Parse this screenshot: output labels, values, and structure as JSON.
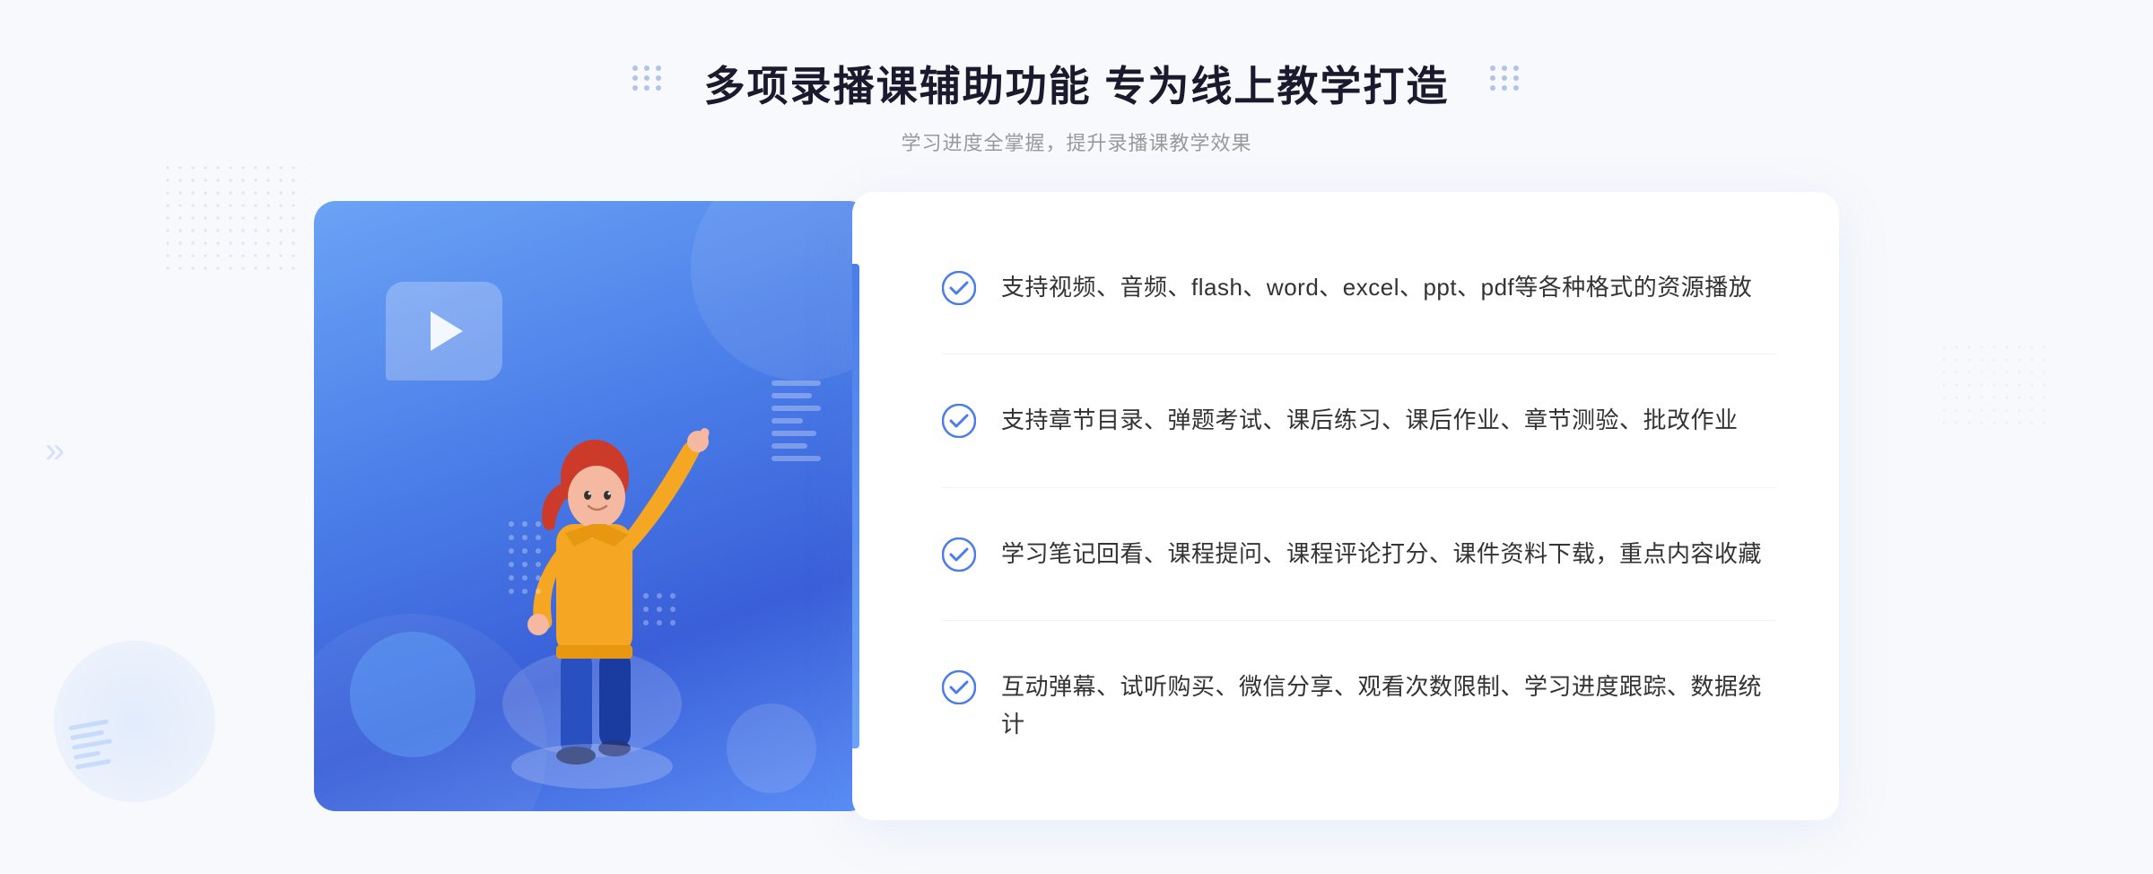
{
  "header": {
    "title": "多项录播课辅助功能 专为线上教学打造",
    "subtitle": "学习进度全掌握，提升录播课教学效果"
  },
  "features": [
    {
      "id": "feature-1",
      "text": "支持视频、音频、flash、word、excel、ppt、pdf等各种格式的资源播放"
    },
    {
      "id": "feature-2",
      "text": "支持章节目录、弹题考试、课后练习、课后作业、章节测验、批改作业"
    },
    {
      "id": "feature-3",
      "text": "学习笔记回看、课程提问、课程评论打分、课件资料下载，重点内容收藏"
    },
    {
      "id": "feature-4",
      "text": "互动弹幕、试听购买、微信分享、观看次数限制、学习进度跟踪、数据统计"
    }
  ],
  "colors": {
    "primary": "#4a7de8",
    "primary_light": "#6ba3f5",
    "text_dark": "#1a1a2e",
    "text_medium": "#333333",
    "text_light": "#999999",
    "accent_bar": "#4a7de8",
    "bg": "#f8f9fc",
    "panel_bg": "#ffffff",
    "check_color": "#4a7de8"
  },
  "decorations": {
    "chevrons_text": "»",
    "play_icon": "▶"
  }
}
